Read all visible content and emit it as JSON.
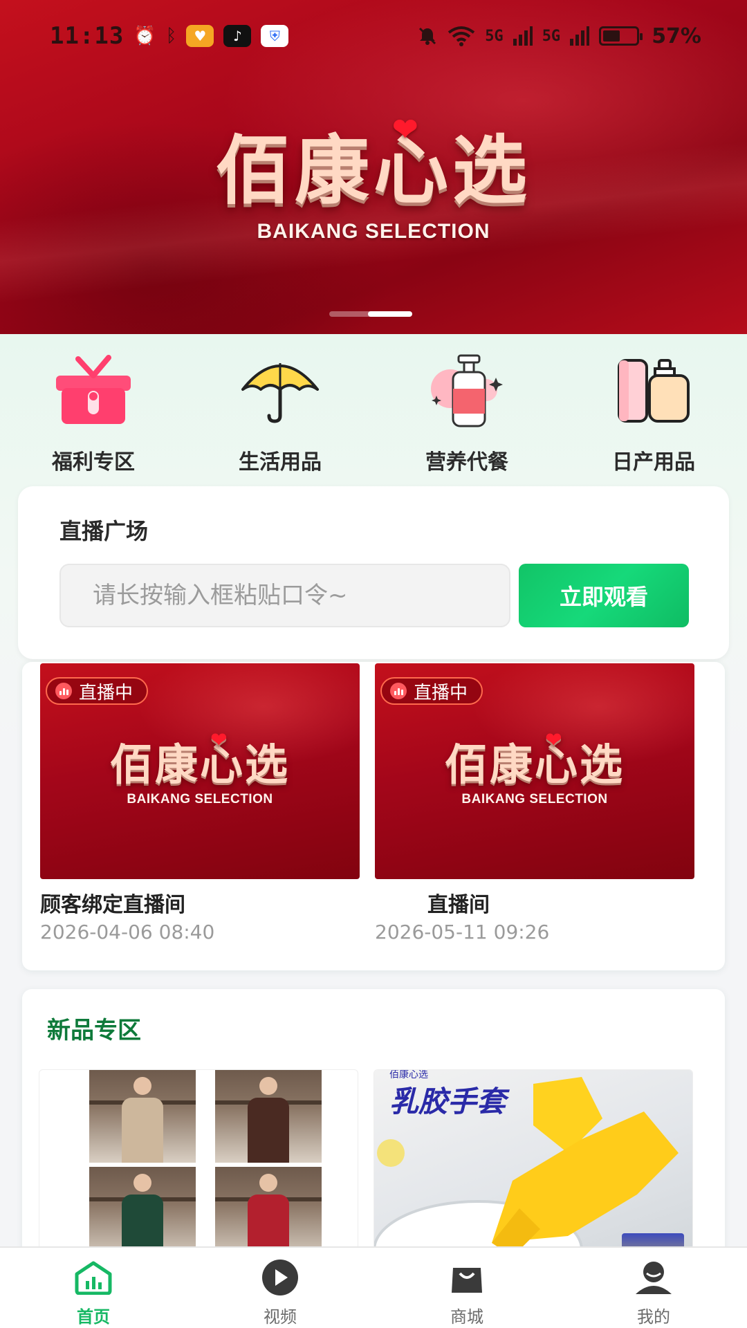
{
  "status_bar": {
    "time": "11:13",
    "signal_1": "5G",
    "signal_2": "5G",
    "battery": "57%"
  },
  "banner": {
    "logo_cn": "佰康心选",
    "logo_en": "BAIKANG SELECTION",
    "pages": 2,
    "active_page": 2
  },
  "categories": [
    {
      "label": "福利专区",
      "icon": "gift-box-icon"
    },
    {
      "label": "生活用品",
      "icon": "umbrella-icon"
    },
    {
      "label": "营养代餐",
      "icon": "pump-bottle-icon"
    },
    {
      "label": "日产用品",
      "icon": "cosmetics-icon"
    }
  ],
  "live_plaza": {
    "title": "直播广场",
    "input_placeholder": "请长按输入框粘贴口令~",
    "watch_button": "立即观看"
  },
  "live_rooms": [
    {
      "badge": "直播中",
      "name": "顾客绑定直播间",
      "time": "2026-04-06 08:40",
      "thumb_cn": "佰康心选",
      "thumb_en": "BAIKANG SELECTION"
    },
    {
      "badge": "直播中",
      "name": "直播间",
      "time": "2026-05-11 09:26",
      "thumb_cn": "佰康心选",
      "thumb_en": "BAIKANG SELECTION"
    }
  ],
  "new_products": {
    "title": "新品专区",
    "glove_title": "乳胶手套",
    "glove_brand": "佰康心选"
  },
  "tabs": [
    {
      "label": "首页",
      "icon": "home-chart-icon",
      "active": true
    },
    {
      "label": "视频",
      "icon": "play-icon",
      "active": false
    },
    {
      "label": "商城",
      "icon": "shopping-bag-icon",
      "active": false
    },
    {
      "label": "我的",
      "icon": "user-icon",
      "active": false
    }
  ],
  "colors": {
    "brand_green": "#16b864",
    "banner_red": "#a4061a",
    "section_title_green": "#0e7a3a"
  }
}
